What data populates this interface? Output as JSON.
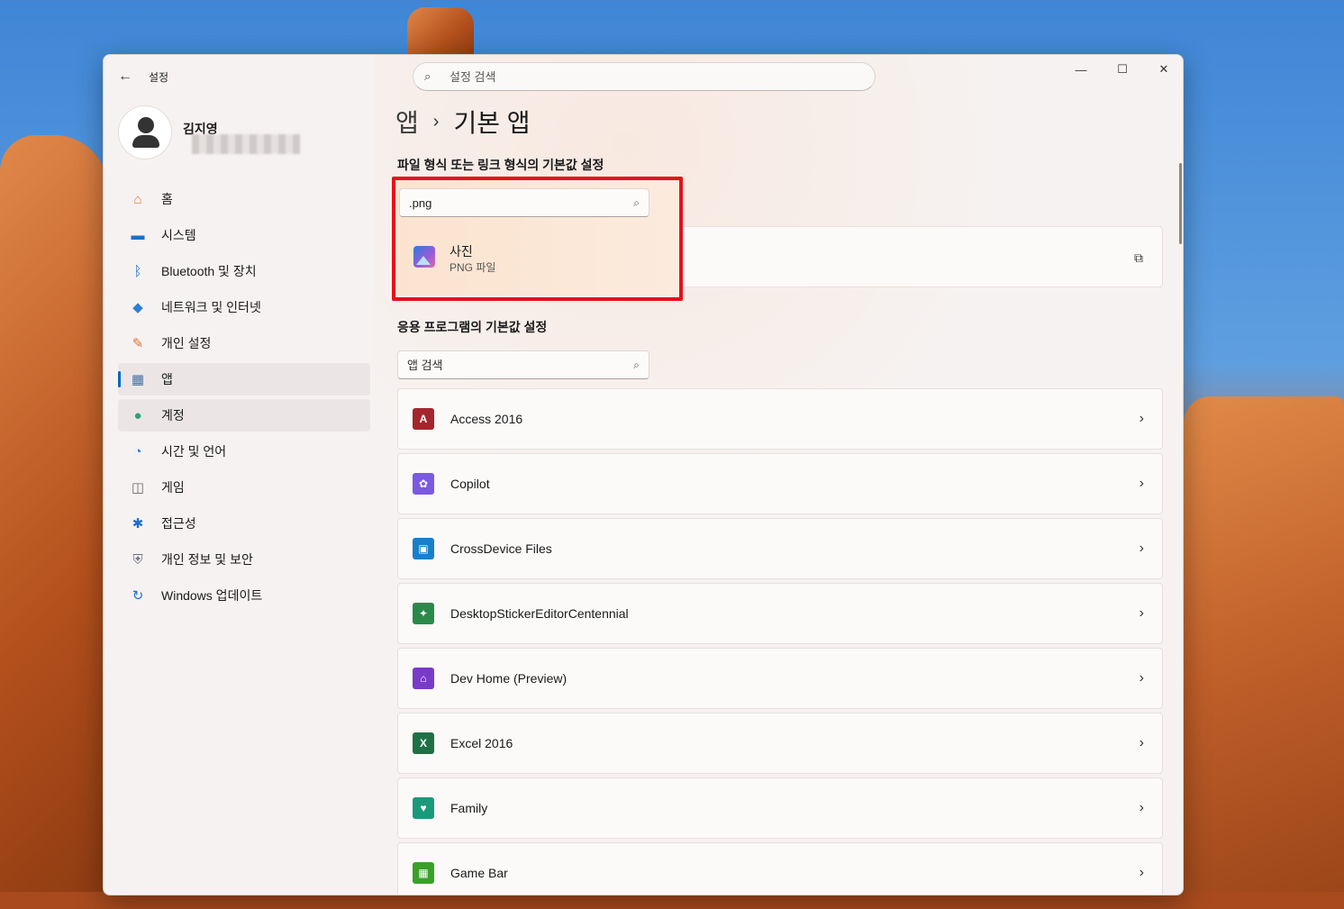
{
  "window": {
    "title": "설정",
    "search_placeholder": "설정 검색",
    "controls": {
      "minimize": "—",
      "maximize": "☐",
      "close": "✕"
    }
  },
  "profile": {
    "name": "김지영"
  },
  "sidebar": {
    "items": [
      {
        "label": "홈",
        "icon": "home-icon",
        "color": "#e07a3a"
      },
      {
        "label": "시스템",
        "icon": "system-icon",
        "color": "#1f6fc4"
      },
      {
        "label": "Bluetooth 및 장치",
        "icon": "bluetooth-icon",
        "color": "#1f6fc4"
      },
      {
        "label": "네트워크 및 인터넷",
        "icon": "wifi-icon",
        "color": "#2a7fd6"
      },
      {
        "label": "개인 설정",
        "icon": "brush-icon",
        "color": "#e0703a"
      },
      {
        "label": "앱",
        "icon": "apps-icon",
        "color": "#4a6fa0"
      },
      {
        "label": "계정",
        "icon": "account-icon",
        "color": "#2aa57a"
      },
      {
        "label": "시간 및 언어",
        "icon": "globe-clock-icon",
        "color": "#2a7fd6"
      },
      {
        "label": "게임",
        "icon": "gamepad-icon",
        "color": "#6a6a6a"
      },
      {
        "label": "접근성",
        "icon": "accessibility-icon",
        "color": "#1a6fd0"
      },
      {
        "label": "개인 정보 및 보안",
        "icon": "shield-icon",
        "color": "#6a7080"
      },
      {
        "label": "Windows 업데이트",
        "icon": "update-icon",
        "color": "#1a6fd0"
      }
    ],
    "selected_index": 5,
    "hover_index": 6
  },
  "breadcrumb": {
    "parent": "앱",
    "separator": "›",
    "current": "기본 앱"
  },
  "file_section": {
    "title": "파일 형식 또는 링크 형식의 기본값 설정",
    "search_value": ".png",
    "result": {
      "title": "사진",
      "subtitle": "PNG 파일",
      "icon": "photos-icon"
    }
  },
  "app_section": {
    "title": "응용 프로그램의 기본값 설정",
    "search_placeholder": "앱 검색",
    "apps": [
      {
        "name": "Access 2016",
        "icon": "access-icon",
        "color": "#a4262c",
        "glyph": "A"
      },
      {
        "name": "Copilot",
        "icon": "copilot-icon",
        "color": "#7a5be0",
        "glyph": "✿"
      },
      {
        "name": "CrossDevice Files",
        "icon": "crossdevice-icon",
        "color": "#1a7fc8",
        "glyph": "▣"
      },
      {
        "name": "DesktopStickerEditorCentennial",
        "icon": "sticker-editor-icon",
        "color": "#2a8a4a",
        "glyph": "✦"
      },
      {
        "name": "Dev Home (Preview)",
        "icon": "devhome-icon",
        "color": "#7a3ac8",
        "glyph": "⌂"
      },
      {
        "name": "Excel 2016",
        "icon": "excel-icon",
        "color": "#1e7145",
        "glyph": "X"
      },
      {
        "name": "Family",
        "icon": "family-icon",
        "color": "#1a9a7a",
        "glyph": "♥"
      },
      {
        "name": "Game Bar",
        "icon": "gamebar-icon",
        "color": "#3aa02a",
        "glyph": "▦"
      }
    ]
  }
}
